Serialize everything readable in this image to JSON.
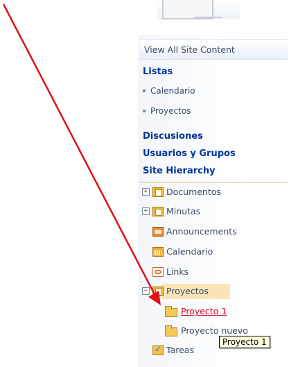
{
  "quick_launch": {
    "view_all": "View All Site Content",
    "listas": {
      "heading": "Listas",
      "items": [
        "Calendario",
        "Proyectos"
      ]
    },
    "discusiones": "Discusiones",
    "usuarios": "Usuarios y Grupos",
    "site_hierarchy": "Site Hierarchy",
    "tree": [
      {
        "label": "Documentos",
        "expander": "+",
        "icon": "document-library-icon"
      },
      {
        "label": "Minutas",
        "expander": "+",
        "icon": "document-library-icon"
      },
      {
        "label": "Announcements",
        "icon": "announcements-icon"
      },
      {
        "label": "Calendario",
        "icon": "calendar-icon"
      },
      {
        "label": "Links",
        "icon": "links-icon"
      },
      {
        "label": "Proyectos",
        "expander": "−",
        "icon": "document-library-icon",
        "selected": true
      },
      {
        "label": "Proyecto 1",
        "icon": "folder-icon",
        "child": true,
        "hover": true
      },
      {
        "label": "Proyecto nuevo",
        "icon": "folder-icon",
        "child": true
      },
      {
        "label": "Tareas",
        "icon": "tasks-icon"
      }
    ]
  },
  "tooltip": "Proyecto 1",
  "colors": {
    "heading": "#003399",
    "hover_link": "#d6001c",
    "selected_bg": "#fbe4b6",
    "arrow": "#e0101a"
  }
}
